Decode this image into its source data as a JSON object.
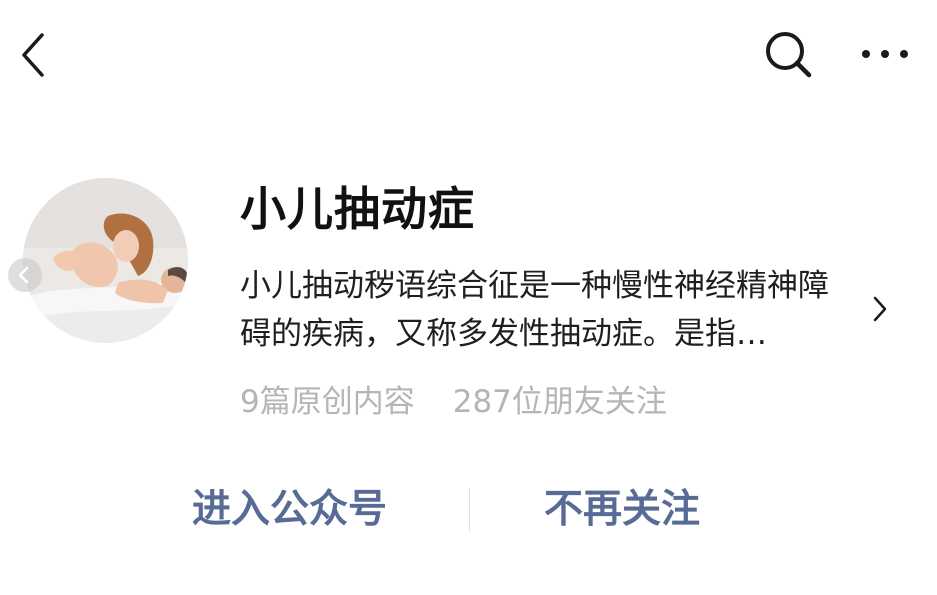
{
  "toolbar": {
    "back_icon": "chevron-left-icon",
    "search_icon": "search-icon",
    "more_icon": "more-horizontal-icon"
  },
  "account": {
    "name": "小儿抽动症",
    "description": "小儿抽动秽语综合征是一种慢性神经精神障碍的疾病，又称多发性抽动症。是指…",
    "original_count_text": "9篇原创内容",
    "followers_text": "287位朋友关注",
    "detail_icon": "chevron-right-icon"
  },
  "actions": {
    "enter_label": "进入公众号",
    "unfollow_label": "不再关注"
  },
  "colors": {
    "action_text": "#576b95",
    "secondary_text": "#b5b5b5",
    "primary_text": "#111111"
  }
}
